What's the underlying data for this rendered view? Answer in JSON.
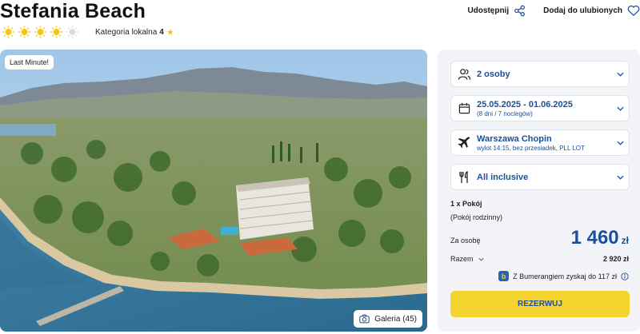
{
  "hotel": {
    "name": "Stefania Beach",
    "sun_rating": 4,
    "sun_total": 5,
    "local_category_label": "Kategoria lokalna",
    "local_category_value": "4"
  },
  "actions": {
    "share_label": "Udostępnij",
    "favorite_label": "Dodaj do ulubionych"
  },
  "photo": {
    "badge": "Last Minute!",
    "gallery_label": "Galeria (45)"
  },
  "booking": {
    "travelers": "2 osoby",
    "dates": "25.05.2025 - 01.06.2025",
    "dates_sub": "(8 dni / 7 noclegów)",
    "departure": "Warszawa Chopin",
    "departure_sub": "wylot 14:15, bez przesiadek, PLL LOT",
    "board": "All inclusive",
    "room_count": "1 x Pokój",
    "room_type": "(Pokój rodzinny)",
    "per_person_label": "Za osobę",
    "price": "1 460",
    "currency": "zł",
    "total_label": "Razem",
    "total_value": "2 920 zł",
    "bumerang_text": "Z Bumerangiem zyskaj do 117 zł",
    "bumerang_logo": "b",
    "reserve_label": "REZERWUJ"
  },
  "colors": {
    "accent_blue": "#1b4f9c",
    "cta_yellow": "#f6d430",
    "sun_yellow": "#f5c518",
    "panel_bg": "#f2f4f7"
  },
  "icons": [
    "sun-icon",
    "star-icon",
    "share-icon",
    "heart-icon",
    "camera-icon",
    "people-icon",
    "calendar-icon",
    "plane-icon",
    "cutlery-icon",
    "chevron-down-icon",
    "info-icon"
  ]
}
